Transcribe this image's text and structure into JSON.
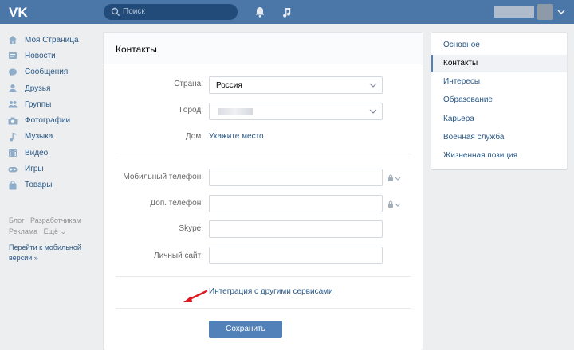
{
  "topbar": {
    "search_placeholder": "Поиск",
    "icons": [
      "vk-logo-icon",
      "search-icon",
      "bell-icon",
      "music-icon",
      "chevron-down-icon"
    ]
  },
  "nav": {
    "items": [
      {
        "label": "Моя Страница",
        "icon": "home-icon"
      },
      {
        "label": "Новости",
        "icon": "news-icon"
      },
      {
        "label": "Сообщения",
        "icon": "messages-icon"
      },
      {
        "label": "Друзья",
        "icon": "friends-icon"
      },
      {
        "label": "Группы",
        "icon": "groups-icon"
      },
      {
        "label": "Фотографии",
        "icon": "camera-icon"
      },
      {
        "label": "Музыка",
        "icon": "music-note-icon"
      },
      {
        "label": "Видео",
        "icon": "video-icon"
      },
      {
        "label": "Игры",
        "icon": "gamepad-icon"
      },
      {
        "label": "Товары",
        "icon": "bag-icon"
      }
    ],
    "footer": {
      "blog": "Блог",
      "developers": "Разработчикам",
      "ads": "Реклама",
      "more": "Ещё",
      "mobile": "Перейти к мобильной версии »"
    }
  },
  "card": {
    "title": "Контакты",
    "country_label": "Страна:",
    "country_value": "Россия",
    "city_label": "Город:",
    "home_label": "Дом:",
    "home_link": "Укажите место",
    "mobile_label": "Мобильный телефон:",
    "mobile_value": "",
    "extra_phone_label": "Доп. телефон:",
    "extra_phone_value": "",
    "skype_label": "Skype:",
    "skype_value": "",
    "site_label": "Личный сайт:",
    "site_value": "",
    "integration_link": "Интеграция с другими сервисами",
    "save_button": "Сохранить"
  },
  "right_menu": {
    "items": [
      "Основное",
      "Контакты",
      "Интересы",
      "Образование",
      "Карьера",
      "Военная служба",
      "Жизненная позиция"
    ],
    "active": "Контакты"
  },
  "colors": {
    "header": "#4a76a8",
    "link": "#2a5885",
    "button": "#5181b8",
    "background": "#edeef0",
    "arrow": "#e0181f"
  }
}
